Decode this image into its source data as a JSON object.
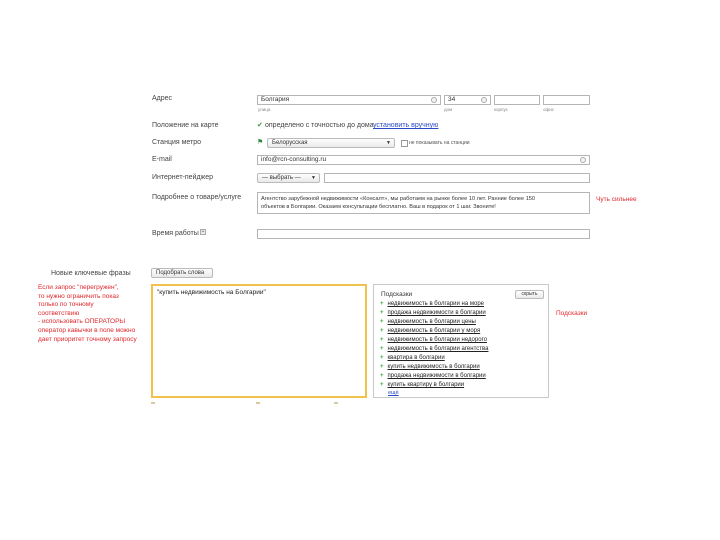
{
  "form": {
    "address": {
      "label": "Адрес",
      "city_value": "Болгария",
      "house_value": "34",
      "sub_city": "улица",
      "sub_house": "дом",
      "sub_corp": "корпус",
      "sub_office": "офис"
    },
    "map_location": {
      "label": "Положение на карте",
      "status": "определено с точностью до дома",
      "link": "установить вручную"
    },
    "metro": {
      "label": "Станция метро",
      "value": "Белорусская",
      "checkbox_label": "не показывать на станции"
    },
    "email": {
      "label": "E-mail",
      "value": "info@rcn-consulting.ru"
    },
    "messenger": {
      "label": "Интернет-пейджер",
      "select_value": "— выбрать —"
    },
    "description": {
      "label": "Подробнее о товаре/услуге",
      "text_line1": "Агентство зарубежной недвижимости «Консалт», мы работаем на рынке более 10 лет. Ранние более 150",
      "text_line2": "объектов в Болгарии. Оказаем консультации бесплатно. Ваш в подарок от 1 шаг. Звоните!",
      "annotation": "Чуть сильнее"
    },
    "workhours": {
      "label": "Время работы"
    }
  },
  "keywords": {
    "label": "Новые ключевые фразы",
    "pick_button": "Подобрать слова",
    "textarea_value": "\"купить недвижимость на Болгарии\"",
    "notes": [
      "Если запрос \"перегружен\",",
      "то нужно ограничить показ",
      "только по точному",
      "соответствию",
      "- использовать ОПЕРАТОРЫ",
      "оператор кавычки в поле можно",
      "дает приоритет точному запросу"
    ]
  },
  "suggestions": {
    "title": "Подсказки",
    "hide_button": "скрыть",
    "items": [
      "недвижимость в болгарии на море",
      "продажа недвижимости в болгарии",
      "недвижимость в болгарии цены",
      "недвижимость в болгарии у моря",
      "недвижимость в болгарии недорого",
      "недвижимость в болгарии агентства",
      "квартира в болгарии",
      "купить недвижимость в болгарии",
      "продажа недвижимости в болгарии",
      "купить квартиру в болгарии"
    ],
    "more": "ещё",
    "annotation": "Подсказки"
  },
  "colors": {
    "accent_link": "#2a4ac8",
    "annotation_red": "#e0262b",
    "textarea_focus": "#f0c14b"
  }
}
